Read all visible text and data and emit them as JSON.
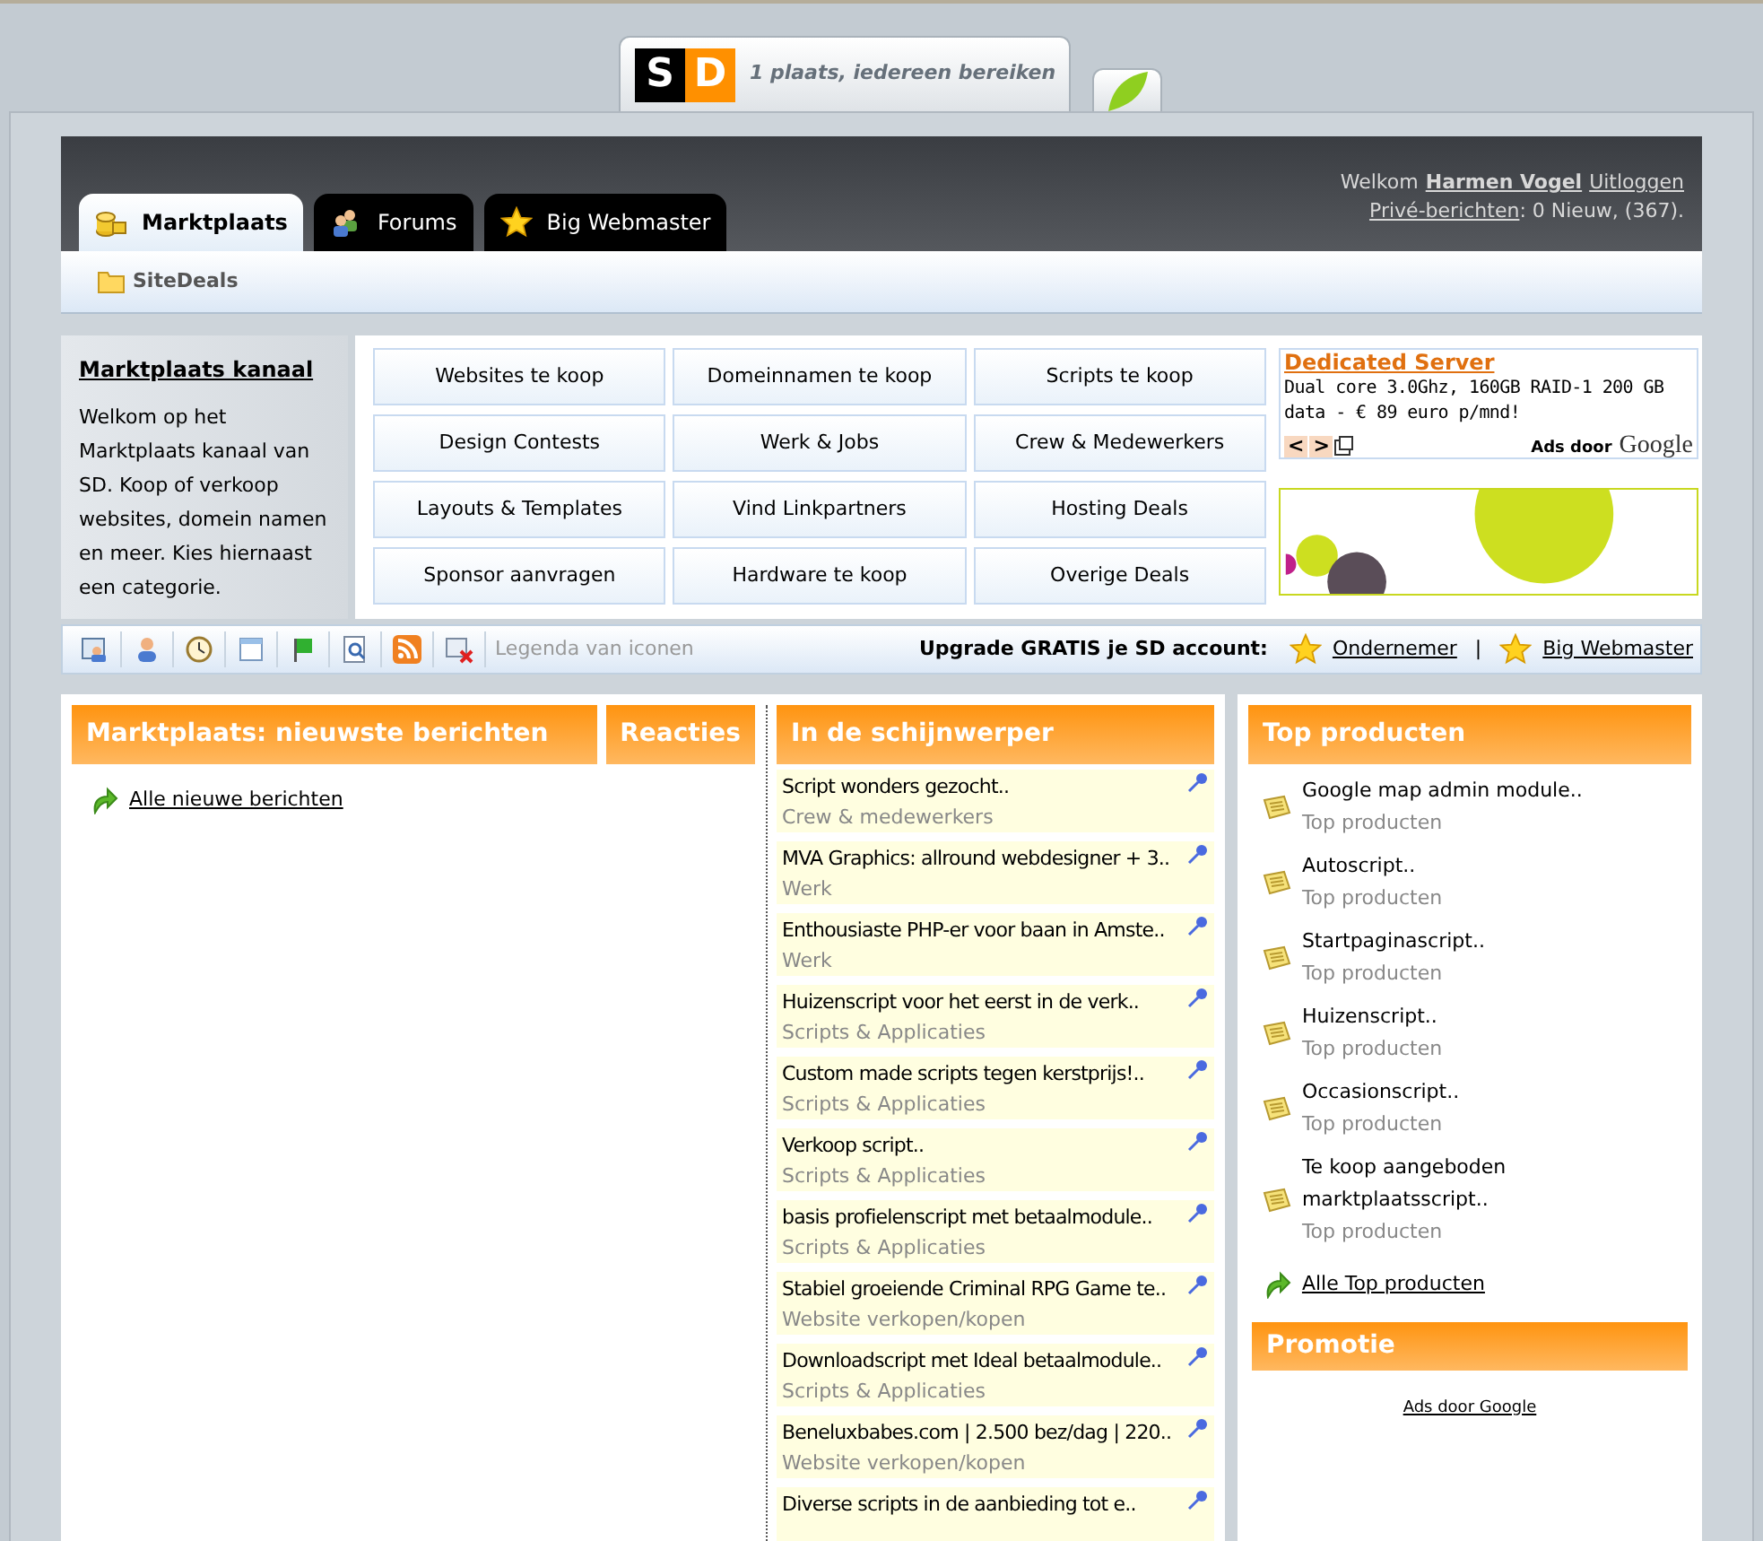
{
  "logo": {
    "mark_left": "S",
    "mark_right": "D",
    "slogan": "1 plaats, iedereen bereiken"
  },
  "header": {
    "tabs": [
      {
        "label": "Marktplaats",
        "selected": true
      },
      {
        "label": "Forums",
        "selected": false
      },
      {
        "label": "Big Webmaster",
        "selected": false
      }
    ],
    "welcome": "Welkom",
    "user": "Harmen Vogel",
    "logout": "Uitloggen",
    "messages_link": "Privé-berichten",
    "messages_count": ": 0 Nieuw, (367)."
  },
  "breadcrumb": "SiteDeals",
  "channel": {
    "title": "Marktplaats kanaal",
    "text": "Welkom op het Marktplaats kanaal van SD. Koop of verkoop websites, domein namen en meer. Kies hiernaast een categorie."
  },
  "categories": [
    "Websites te koop",
    "Domeinnamen te koop",
    "Scripts te koop",
    "Design Contests",
    "Werk & Jobs",
    "Crew & Medewerkers",
    "Layouts & Templates",
    "Vind Linkpartners",
    "Hosting Deals",
    "Sponsor aanvragen",
    "Hardware te koop",
    "Overige Deals"
  ],
  "ad": {
    "title": "Dedicated Server",
    "text": "Dual core 3.0Ghz, 160GB RAID-1 200 GB data - € 89 euro p/mnd!",
    "prev": "<",
    "next": ">",
    "ads_by": "Ads door",
    "google": "Google"
  },
  "toolbar": {
    "legend": "Legenda van iconen",
    "upgrade": "Upgrade GRATIS je SD account:",
    "links": [
      "Ondernemer",
      "Big Webmaster"
    ],
    "separator": "|"
  },
  "newest": {
    "title": "Marktplaats: nieuwste berichten",
    "reactions": "Reacties",
    "all_link": "Alle nieuwe berichten"
  },
  "spotlight": {
    "title": "In de schijnwerper",
    "items": [
      {
        "title": "Script wonders gezocht..",
        "category": "Crew & medewerkers"
      },
      {
        "title": "MVA Graphics: allround webdesigner + 3..",
        "category": "Werk"
      },
      {
        "title": "Enthousiaste PHP-er voor baan in Amste..",
        "category": "Werk"
      },
      {
        "title": "Huizenscript voor het eerst in de verk..",
        "category": "Scripts & Applicaties"
      },
      {
        "title": "Custom made scripts tegen kerstprijs!..",
        "category": "Scripts & Applicaties"
      },
      {
        "title": "Verkoop script..",
        "category": "Scripts & Applicaties"
      },
      {
        "title": "basis profielenscript met betaalmodule..",
        "category": "Scripts & Applicaties"
      },
      {
        "title": "Stabiel groeiende Criminal RPG Game te..",
        "category": "Website verkopen/kopen"
      },
      {
        "title": "Downloadscript met Ideal betaalmodule..",
        "category": "Scripts & Applicaties"
      },
      {
        "title": "Beneluxbabes.com | 2.500 bez/dag | 220..",
        "category": "Website verkopen/kopen"
      },
      {
        "title": "Diverse scripts in de aanbieding tot e.."
      }
    ]
  },
  "top_products": {
    "title": "Top producten",
    "items": [
      {
        "title": "Google map admin module..",
        "category": "Top producten"
      },
      {
        "title": "Autoscript..",
        "category": "Top producten"
      },
      {
        "title": "Startpaginascript..",
        "category": "Top producten"
      },
      {
        "title": "Huizenscript..",
        "category": "Top producten"
      },
      {
        "title": "Occasionscript..",
        "category": "Top producten"
      },
      {
        "title": "Te koop aangeboden marktplaatsscript..",
        "category": "Top producten"
      }
    ],
    "all_link": "Alle Top producten"
  },
  "promotion": {
    "title": "Promotie",
    "ads_link": "Ads door Google"
  }
}
